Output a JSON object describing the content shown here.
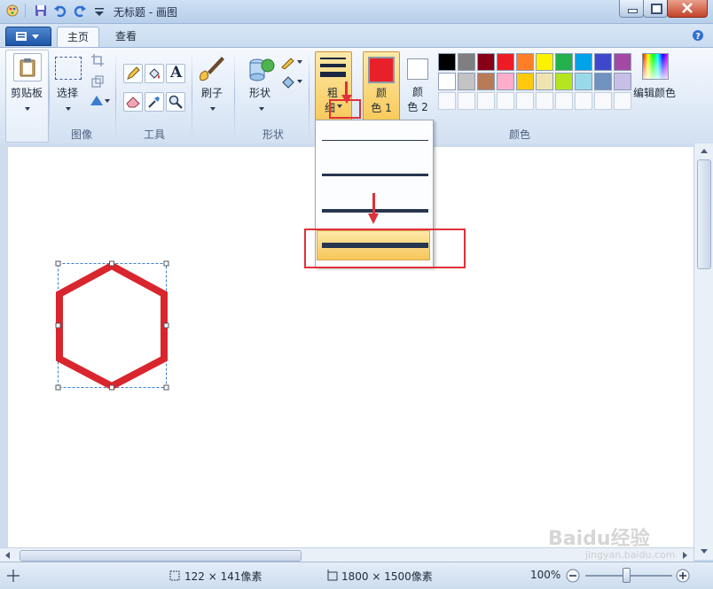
{
  "window": {
    "title": "无标题 - 画图"
  },
  "tabs": [
    {
      "label": "主页",
      "active": true
    },
    {
      "label": "查看",
      "active": false
    }
  ],
  "ribbon": {
    "clipboard": {
      "label": "剪贴板"
    },
    "select": {
      "label": "选择"
    },
    "image_group": "图像",
    "tools_group": "工具",
    "brush": {
      "label": "刷子"
    },
    "shapes": {
      "label": "形状"
    },
    "shapes_group": "形状",
    "size": {
      "label_line1": "粗",
      "label_line2": "细"
    },
    "color1": {
      "label_line1": "颜",
      "label_line2": "色 1",
      "value": "#e8202a"
    },
    "color2": {
      "label_line1": "颜",
      "label_line2": "色 2",
      "value": "#ffffff"
    },
    "edit_colors": {
      "label": "编辑颜色"
    },
    "colors_group": "颜色",
    "text_tool_glyph": "A",
    "palette_row1": [
      "#000000",
      "#7f7f7f",
      "#880015",
      "#ed1c24",
      "#ff7f27",
      "#fff200",
      "#22b14c",
      "#00a2e8",
      "#3f48cc",
      "#a349a4"
    ],
    "palette_row2": [
      "#ffffff",
      "#c3c3c3",
      "#b97a57",
      "#ffaec9",
      "#ffc90e",
      "#efe4b0",
      "#b5e61d",
      "#99d9ea",
      "#7092be",
      "#c8bfe7"
    ]
  },
  "size_menu": {
    "options": [
      {
        "thickness": 1,
        "selected": false
      },
      {
        "thickness": 3,
        "selected": false
      },
      {
        "thickness": 5,
        "selected": false
      },
      {
        "thickness": 8,
        "selected": true
      }
    ]
  },
  "canvas": {
    "shape": "hexagon",
    "stroke_color": "#d9252d"
  },
  "status": {
    "selection_size": "122 × 141像素",
    "image_size": "1800 × 1500像素",
    "zoom": "100%"
  },
  "watermark": {
    "text": "Baidu经验",
    "url": "jingyan.baidu.com"
  }
}
